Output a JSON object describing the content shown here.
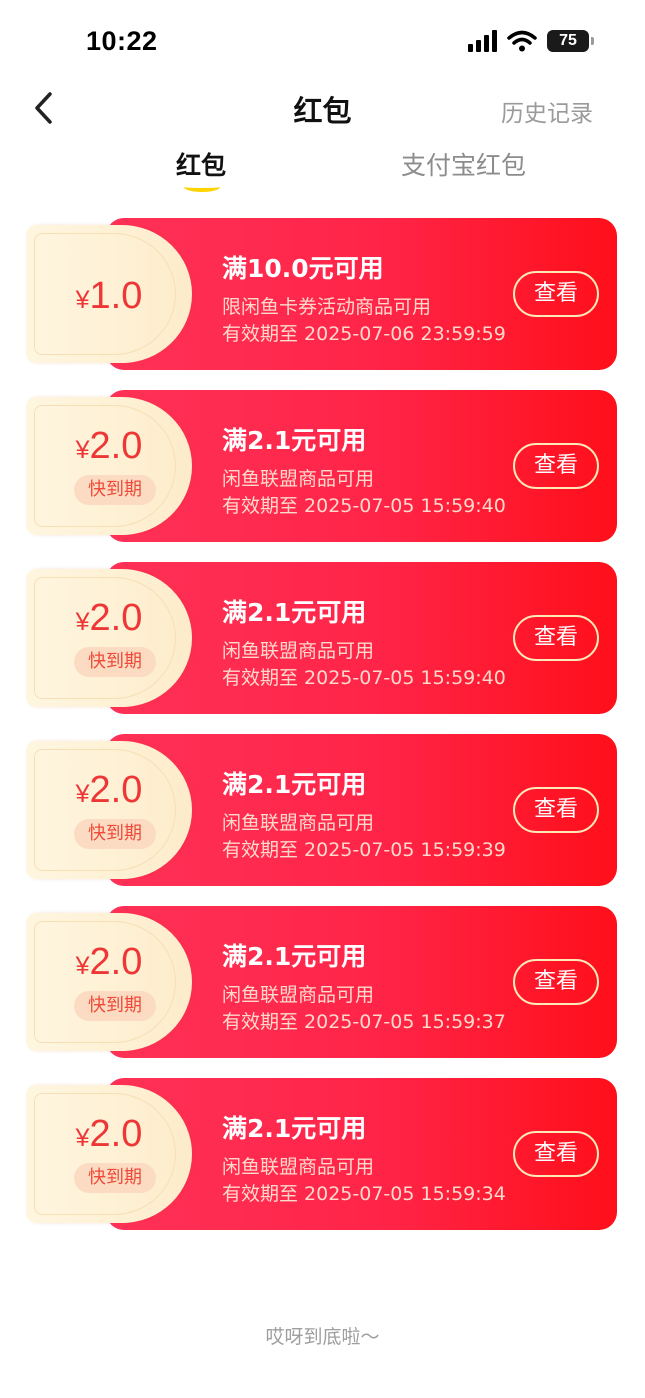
{
  "status_bar": {
    "time": "10:22",
    "battery": "75"
  },
  "nav": {
    "title": "红包",
    "history": "历史记录"
  },
  "tabs": [
    {
      "label": "红包",
      "active": true
    },
    {
      "label": "支付宝红包",
      "active": false
    }
  ],
  "coupons": [
    {
      "currency": "¥",
      "amount": "1.0",
      "badge": "",
      "title": "满10.0元可用",
      "desc": "限闲鱼卡券活动商品可用",
      "date": "有效期至 2025-07-06 23:59:59",
      "button": "查看"
    },
    {
      "currency": "¥",
      "amount": "2.0",
      "badge": "快到期",
      "title": "满2.1元可用",
      "desc": "闲鱼联盟商品可用",
      "date": "有效期至 2025-07-05 15:59:40",
      "button": "查看"
    },
    {
      "currency": "¥",
      "amount": "2.0",
      "badge": "快到期",
      "title": "满2.1元可用",
      "desc": "闲鱼联盟商品可用",
      "date": "有效期至 2025-07-05 15:59:40",
      "button": "查看"
    },
    {
      "currency": "¥",
      "amount": "2.0",
      "badge": "快到期",
      "title": "满2.1元可用",
      "desc": "闲鱼联盟商品可用",
      "date": "有效期至 2025-07-05 15:59:39",
      "button": "查看"
    },
    {
      "currency": "¥",
      "amount": "2.0",
      "badge": "快到期",
      "title": "满2.1元可用",
      "desc": "闲鱼联盟商品可用",
      "date": "有效期至 2025-07-05 15:59:37",
      "button": "查看"
    },
    {
      "currency": "¥",
      "amount": "2.0",
      "badge": "快到期",
      "title": "满2.1元可用",
      "desc": "闲鱼联盟商品可用",
      "date": "有效期至 2025-07-05 15:59:34",
      "button": "查看"
    }
  ],
  "footer": {
    "end_text": "哎呀到底啦～"
  },
  "colors": {
    "coupon_red": "#ff2447",
    "amount_red": "#ee3636",
    "tab_underline": "#ffd400",
    "coupon_cream": "#fdeccb"
  }
}
